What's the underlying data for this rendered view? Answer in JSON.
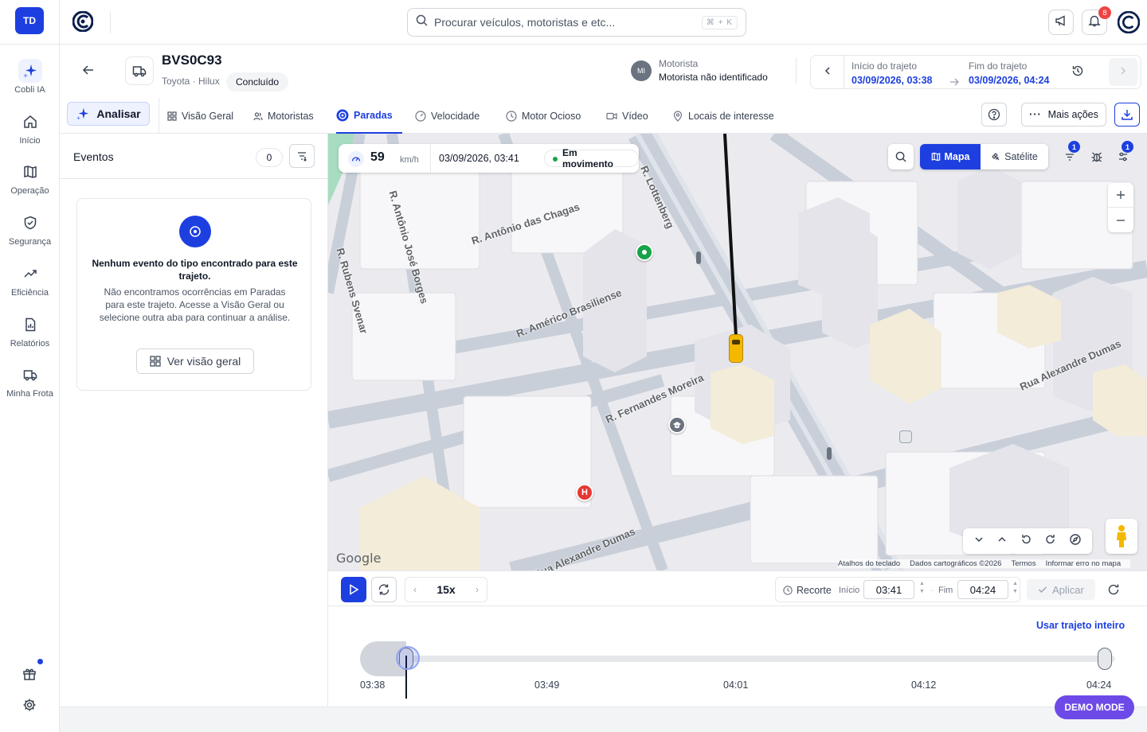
{
  "rail": {
    "avatar": "TD",
    "items": [
      {
        "label": "Cobli IA",
        "icon": "sparkle-icon"
      },
      {
        "label": "Início",
        "icon": "home-icon"
      },
      {
        "label": "Operação",
        "icon": "map-book-icon"
      },
      {
        "label": "Segurança",
        "icon": "shield-icon"
      },
      {
        "label": "Eficiência",
        "icon": "trend-up-icon"
      },
      {
        "label": "Relatórios",
        "icon": "report-icon"
      },
      {
        "label": "Minha Frota",
        "icon": "truck-icon"
      }
    ],
    "footer_icons": [
      "gift-icon",
      "gear-icon"
    ]
  },
  "topbar": {
    "search_placeholder": "Procurar veículos, motoristas e etc...",
    "shortcut": "⌘ + K",
    "notifications_count": "8"
  },
  "vehicle": {
    "plate": "BVS0C93",
    "model": "Toyota · Hilux",
    "status": "Concluído",
    "driver_label": "Motorista",
    "driver_value": "Motorista não identificado",
    "driver_initials": "MI"
  },
  "trip": {
    "start_label": "Início do trajeto",
    "start_value": "03/09/2026, 03:38",
    "end_label": "Fim do trajeto",
    "end_value": "03/09/2026, 04:24"
  },
  "tabs": {
    "analyze": "Analisar",
    "items": [
      "Visão Geral",
      "Motoristas",
      "Paradas",
      "Velocidade",
      "Motor Ocioso",
      "Vídeo",
      "Locais de interesse"
    ],
    "active": "Paradas",
    "more": "Mais ações"
  },
  "events": {
    "title": "Eventos",
    "count": "0",
    "empty_title": "Nenhum evento do tipo encontrado para este trajeto.",
    "empty_desc": "Não encontramos ocorrências em Paradas para este trajeto. Acesse a Visão Geral ou selecione outra aba para continuar a análise.",
    "empty_button": "Ver visão geral"
  },
  "map": {
    "speed": "59",
    "speed_unit": "km/h",
    "datetime": "03/09/2026, 03:41",
    "moving_status": "Em movimento",
    "type_map": "Mapa",
    "type_satellite": "Satélite",
    "filter_badge": "1",
    "settings_badge": "1",
    "streets": [
      "R. Antônio das Chagas",
      "R. Antônio José Borges",
      "R. Rubens Svenar",
      "R. Américo Brasiliense",
      "R. Fernandes Moreira",
      "Rua Alexandre Dumas",
      "Rua Alexandre Dumas",
      "R. Lottenberg"
    ],
    "google": "Google",
    "attribution": [
      "Atalhos do teclado",
      "Dados cartográficos ©2026",
      "Termos",
      "Informar erro no mapa"
    ],
    "colors": {
      "route": "#111111",
      "vehicle": "#f5b800",
      "accent": "#1d3fe0"
    }
  },
  "player": {
    "speed": "15x",
    "recorte_label": "Recorte",
    "start_small": "Início",
    "start_time": "03:41",
    "end_small": "Fim",
    "end_time": "04:24",
    "apply": "Aplicar"
  },
  "timeline": {
    "use_full": "Usar trajeto inteiro",
    "ticks": [
      "03:38",
      "03:49",
      "04:01",
      "04:12",
      "04:24"
    ]
  },
  "demo_mode": "DEMO MODE"
}
